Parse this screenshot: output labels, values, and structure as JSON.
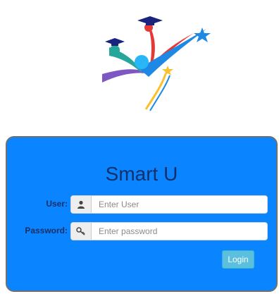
{
  "login": {
    "title": "Smart U",
    "user_label": "User:",
    "user_placeholder": "Enter User",
    "user_value": "",
    "password_label": "Password:",
    "password_placeholder": "Enter password",
    "password_value": "",
    "login_button": "Login"
  },
  "icons": {
    "logo": "graduation-figures-logo",
    "user": "user-icon",
    "password": "key-icon"
  },
  "colors": {
    "panel_bg": "#0a84ff",
    "panel_border": "#707070",
    "title": "#12306b",
    "label": "#1a2f66",
    "button_bg": "#5bc0de"
  }
}
